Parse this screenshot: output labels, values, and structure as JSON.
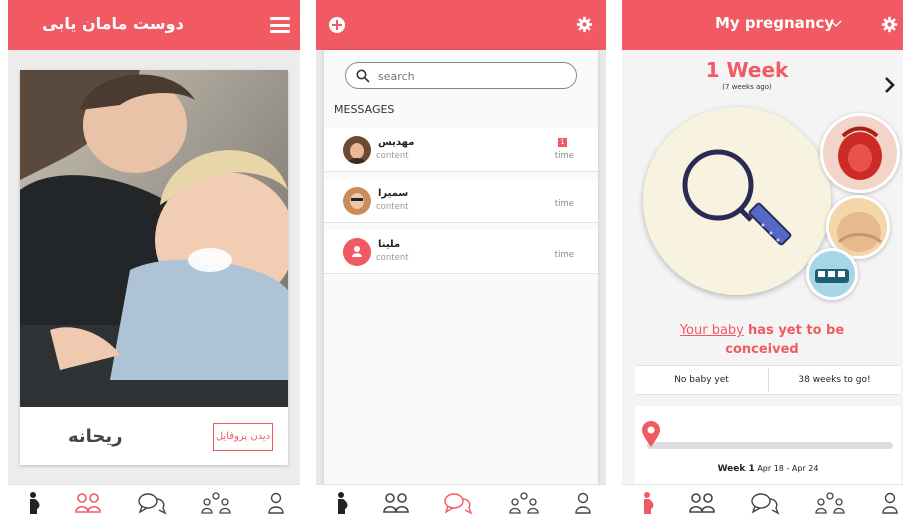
{
  "theme": {
    "accent": "#f25a63"
  },
  "screen1": {
    "title": "دوست مامان یابی",
    "menu_icon": "hamburger-icon",
    "card": {
      "name": "ریحانه",
      "profile_button": "دیدن پروفایل"
    }
  },
  "screen2": {
    "add_icon": "plus-circle-icon",
    "settings_icon": "gear-icon",
    "search": {
      "placeholder": "search",
      "value": ""
    },
    "section_title": "MESSAGES",
    "messages": [
      {
        "name": "مهدیس",
        "content": "content",
        "time": "time",
        "unread": "1"
      },
      {
        "name": "سمیرا",
        "content": "content",
        "time": "time"
      },
      {
        "name": "ملینا",
        "content": "content",
        "time": "time"
      }
    ]
  },
  "screen3": {
    "title": "My pregnancy",
    "week": "1 Week",
    "weeks_ago": "(7 weeks ago)",
    "status_highlight": "Your baby",
    "status_rest": "has yet to be conceived",
    "stat_left": "No baby yet",
    "stat_right": "38 weeks to go!",
    "progress": 0.0,
    "timeline_week": "Week 1",
    "timeline_range": "Apr 18 - Apr 24"
  },
  "tabbar": {
    "icons": [
      "pregnant-icon",
      "friends-icon",
      "chat-icon",
      "group-icon",
      "profile-icon"
    ]
  }
}
